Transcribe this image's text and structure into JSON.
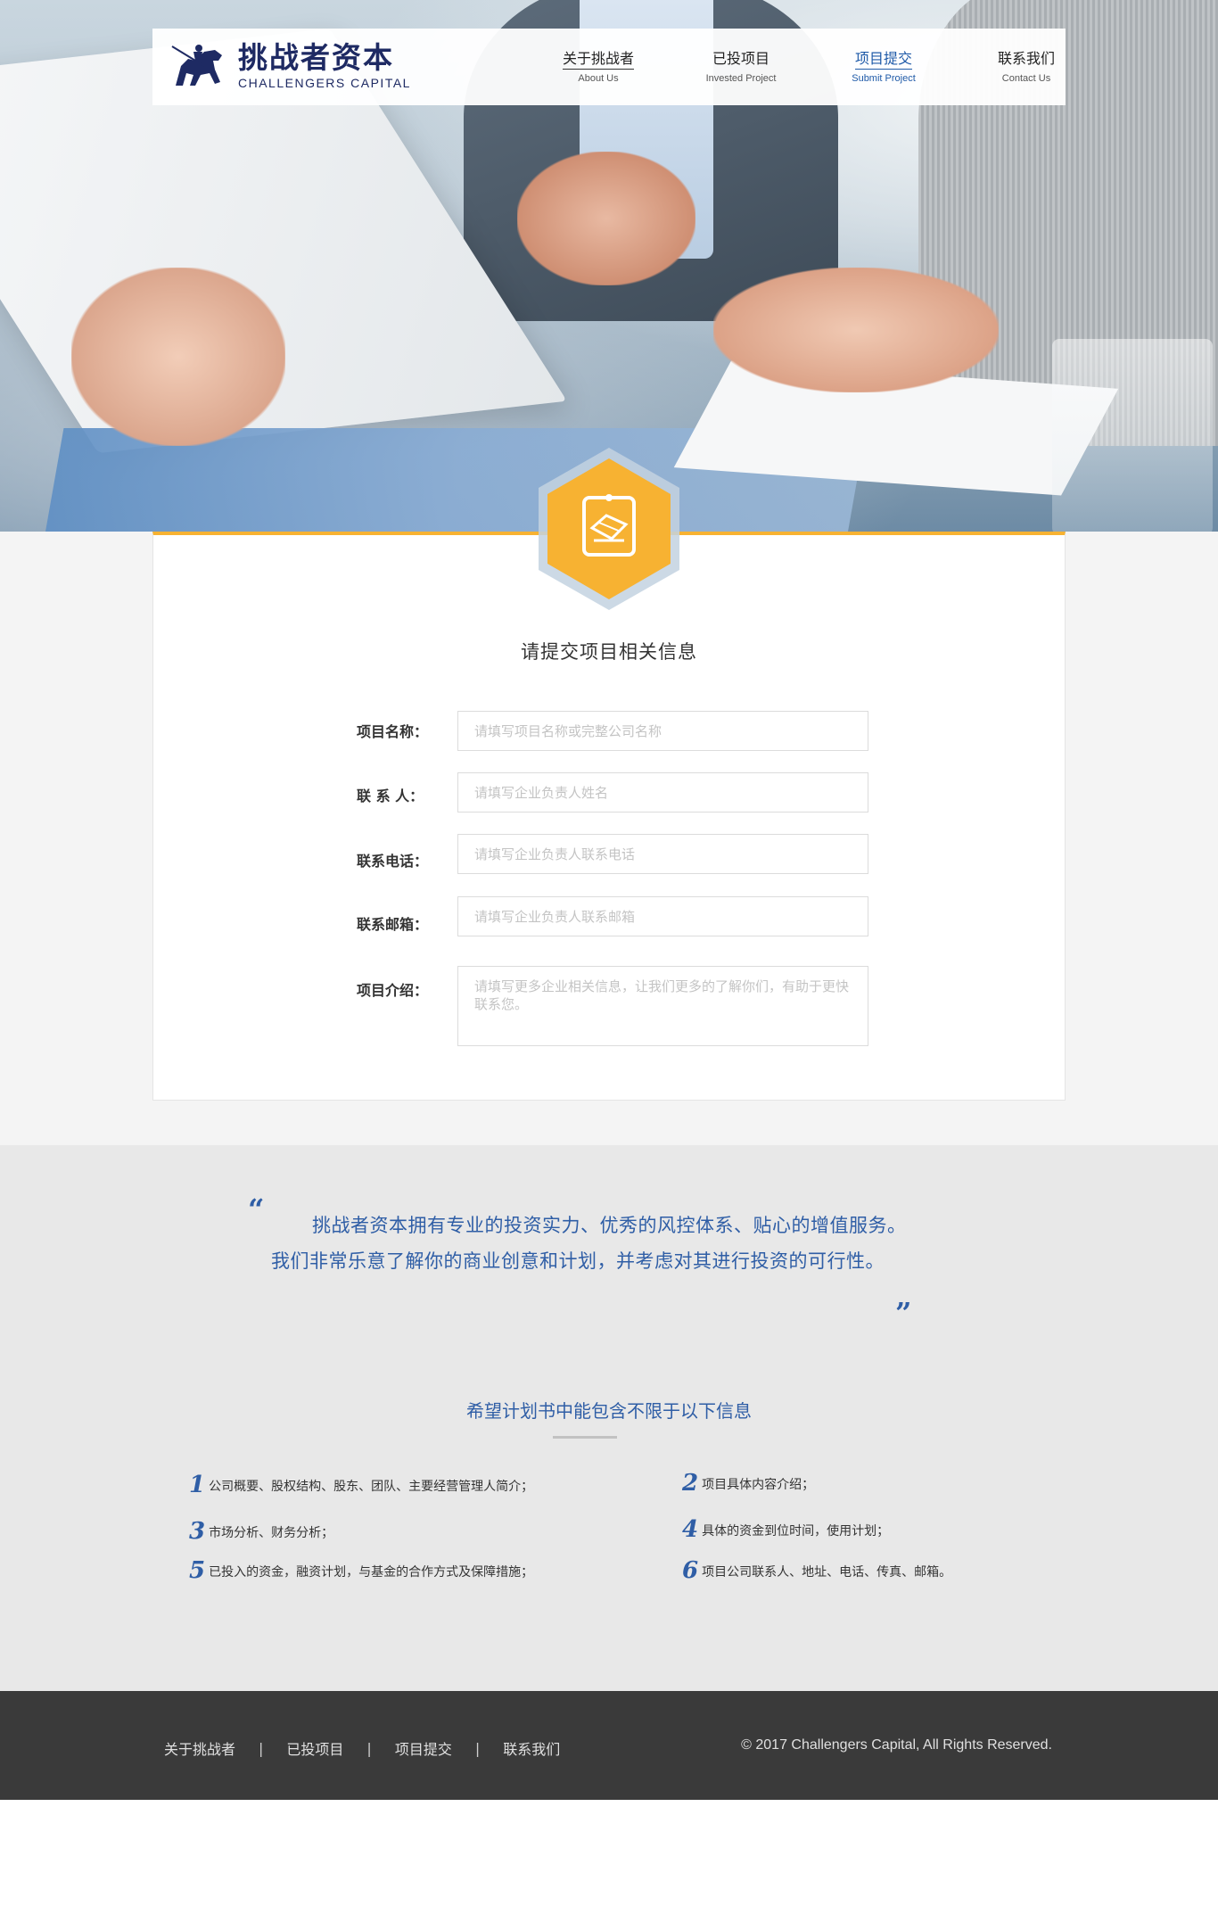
{
  "brand": {
    "name_cn": "挑战者资本",
    "name_en": "CHALLENGERS CAPITAL"
  },
  "nav": {
    "items": [
      {
        "cn": "关于挑战者",
        "en": "About Us"
      },
      {
        "cn": "已投项目",
        "en": "Invested Project"
      },
      {
        "cn": "项目提交",
        "en": "Submit Project"
      },
      {
        "cn": "联系我们",
        "en": "Contact Us"
      }
    ],
    "active_index": 2
  },
  "form": {
    "title": "请提交项目相关信息",
    "fields": [
      {
        "label": "项目名称：",
        "placeholder": "请填写项目名称或完整公司名称"
      },
      {
        "label": "联 系 人：",
        "placeholder": "请填写企业负责人姓名"
      },
      {
        "label": "联系电话：",
        "placeholder": "请填写企业负责人联系电话"
      },
      {
        "label": "联系邮箱：",
        "placeholder": "请填写企业负责人联系邮箱"
      },
      {
        "label": "项目介绍：",
        "placeholder": "请填写更多企业相关信息，让我们更多的了解你们，有助于更快联系您。"
      }
    ]
  },
  "quote": {
    "open_mark": "“",
    "close_mark": "”",
    "text": "挑战者资本拥有专业的投资实力、优秀的风控体系、贴心的增值服务。我们非常乐意了解你的商业创意和计划，并考虑对其进行投资的可行性。"
  },
  "plan": {
    "title": "希望计划书中能包含不限于以下信息",
    "items": [
      {
        "num": "1",
        "text": "公司概要、股权结构、股东、团队、主要经营管理人简介；"
      },
      {
        "num": "2",
        "text": "项目具体内容介绍；"
      },
      {
        "num": "3",
        "text": "市场分析、财务分析；"
      },
      {
        "num": "4",
        "text": "具体的资金到位时间，使用计划；"
      },
      {
        "num": "5",
        "text": "已投入的资金，融资计划，与基金的合作方式及保障措施；"
      },
      {
        "num": "6",
        "text": "项目公司联系人、地址、电话、传真、邮箱。"
      }
    ]
  },
  "footer": {
    "links": [
      "关于挑战者",
      "已投项目",
      "项目提交",
      "联系我们"
    ],
    "separator": "|",
    "copyright": "© 2017 Challengers Capital, All Rights Reserved."
  },
  "colors": {
    "accent_orange": "#f7b232",
    "brand_blue": "#2f5ea6",
    "brand_navy": "#1e2a63",
    "footer_bg": "#3a3a3a"
  },
  "icons": {
    "logo": "knight-horse-icon",
    "form_badge": "document-hexagon-icon"
  }
}
